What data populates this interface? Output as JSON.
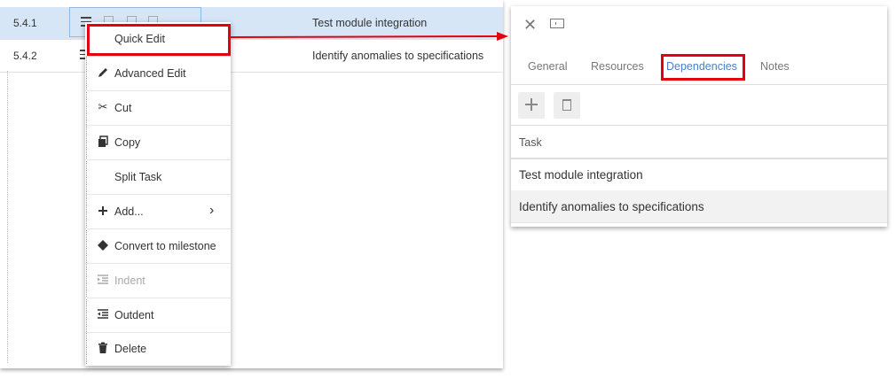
{
  "grid": {
    "rows": [
      {
        "wbs": "5.4.1",
        "name": "Test module integration"
      },
      {
        "wbs": "5.4.2",
        "name": "Identify anomalies to specifications"
      }
    ]
  },
  "context_menu": {
    "items": [
      {
        "label": "Quick Edit",
        "icon": "none"
      },
      {
        "label": "Advanced Edit",
        "icon": "pencil-icon"
      },
      {
        "label": "Cut",
        "icon": "scissors-icon"
      },
      {
        "label": "Copy",
        "icon": "copy-icon"
      },
      {
        "label": "Split Task",
        "icon": "none"
      },
      {
        "label": "Add...",
        "icon": "plus-icon"
      },
      {
        "label": "Convert to milestone",
        "icon": "diamond-icon"
      },
      {
        "label": "Indent",
        "icon": "indent-icon"
      },
      {
        "label": "Outdent",
        "icon": "outdent-icon"
      },
      {
        "label": "Delete",
        "icon": "trash-icon"
      }
    ]
  },
  "detail": {
    "tabs": [
      "General",
      "Resources",
      "Dependencies",
      "Notes"
    ],
    "active_tab": "Dependencies",
    "column_header": "Task",
    "dependencies": [
      "Test module integration",
      "Identify anomalies to specifications"
    ]
  },
  "colors": {
    "highlight": "#e3000f",
    "selected_row": "#d6e6f7",
    "active_tab": "#4a7fc8"
  }
}
